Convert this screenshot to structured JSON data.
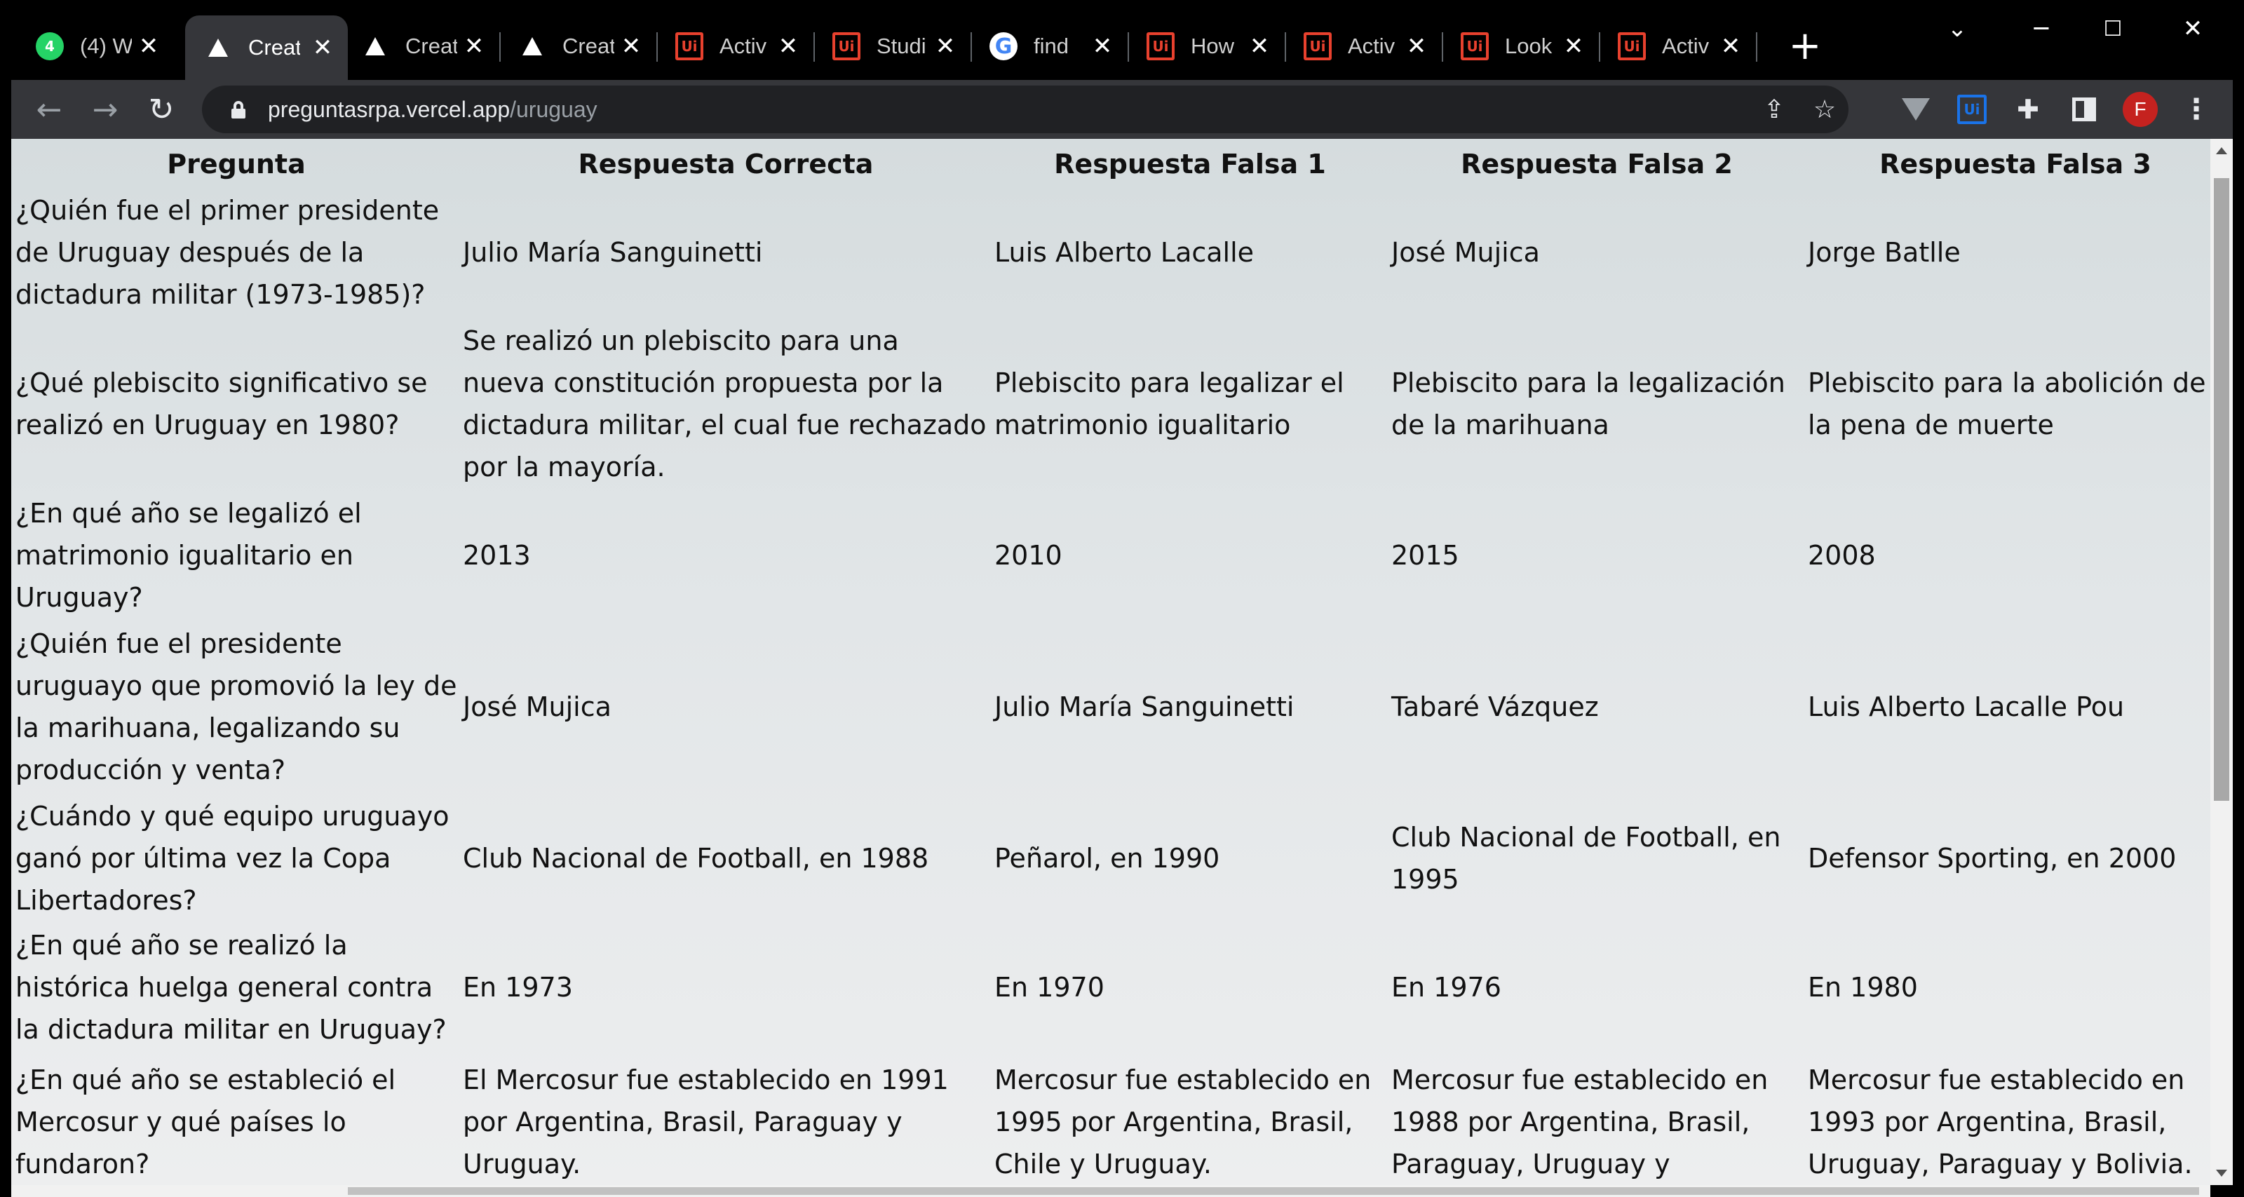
{
  "tabs": [
    {
      "title": "(4) W",
      "icon": "whatsapp-icon",
      "active": false
    },
    {
      "title": "Creat",
      "icon": "vercel-icon",
      "active": true
    },
    {
      "title": "Creat",
      "icon": "vercel-icon",
      "active": false
    },
    {
      "title": "Creat",
      "icon": "vercel-icon",
      "active": false
    },
    {
      "title": "Activ",
      "icon": "uipath-icon",
      "active": false
    },
    {
      "title": "Studi",
      "icon": "uipath-icon",
      "active": false
    },
    {
      "title": "find",
      "icon": "google-icon",
      "active": false
    },
    {
      "title": "How",
      "icon": "uipath-icon",
      "active": false
    },
    {
      "title": "Activ",
      "icon": "uipath-icon",
      "active": false
    },
    {
      "title": "Look",
      "icon": "uipath-icon",
      "active": false
    },
    {
      "title": "Activ",
      "icon": "uipath-icon",
      "active": false
    }
  ],
  "favicon_text": {
    "whatsapp": "4",
    "uipath": "Ui",
    "google": "G"
  },
  "address_bar": {
    "domain": "preguntasrpa.vercel.app",
    "path": "/uruguay"
  },
  "profile": {
    "initial": "F",
    "color": "#c5221f"
  },
  "table": {
    "headers": [
      "Pregunta",
      "Respuesta Correcta",
      "Respuesta Falsa 1",
      "Respuesta Falsa 2",
      "Respuesta Falsa 3"
    ],
    "rows": [
      [
        "¿Quién fue el primer presidente de Uruguay después de la dictadura militar (1973-1985)?",
        "Julio María Sanguinetti",
        "Luis Alberto Lacalle",
        "José Mujica",
        "Jorge Batlle"
      ],
      [
        "¿Qué plebiscito significativo se realizó en Uruguay en 1980?",
        "Se realizó un plebiscito para una nueva constitución propuesta por la dictadura militar, el cual fue rechazado por la mayoría.",
        "Plebiscito para legalizar el matrimonio igualitario",
        "Plebiscito para la legalización de la marihuana",
        "Plebiscito para la abolición de la pena de muerte"
      ],
      [
        "¿En qué año se legalizó el matrimonio igualitario en Uruguay?",
        "2013",
        "2010",
        "2015",
        "2008"
      ],
      [
        "¿Quién fue el presidente uruguayo que promovió la ley de la marihuana, legalizando su producción y venta?",
        "José Mujica",
        "Julio María Sanguinetti",
        "Tabaré Vázquez",
        "Luis Alberto Lacalle Pou"
      ],
      [
        "¿Cuándo y qué equipo uruguayo ganó por última vez la Copa Libertadores?",
        "Club Nacional de Football, en 1988",
        "Peñarol, en 1990",
        "Club Nacional de Football, en 1995",
        "Defensor Sporting, en 2000"
      ],
      [
        "¿En qué año se realizó la histórica huelga general contra la dictadura militar en Uruguay?",
        "En 1973",
        "En 1970",
        "En 1976",
        "En 1980"
      ],
      [
        "¿En qué año se estableció el Mercosur y qué países lo fundaron?",
        "El Mercosur fue establecido en 1991 por Argentina, Brasil, Paraguay y Uruguay.",
        "Mercosur fue establecido en 1995 por Argentina, Brasil, Chile y Uruguay.",
        "Mercosur fue establecido en 1988 por Argentina, Brasil, Paraguay, Uruguay y",
        "Mercosur fue establecido en 1993 por Argentina, Brasil, Uruguay, Paraguay y Bolivia."
      ]
    ]
  }
}
